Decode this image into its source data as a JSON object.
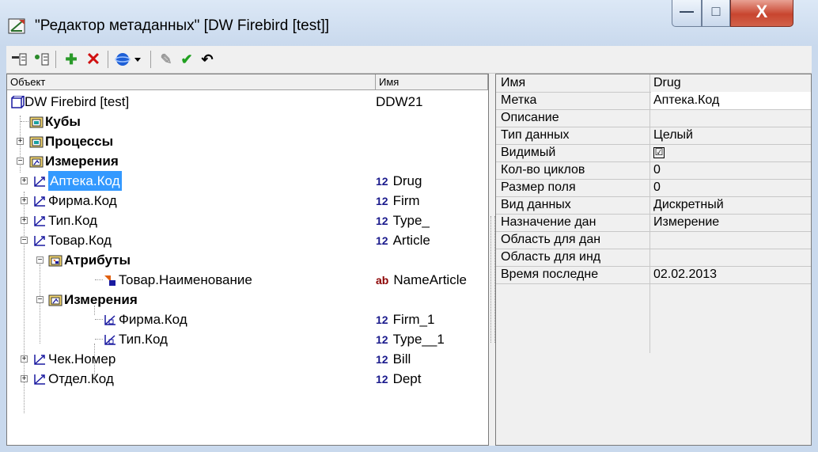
{
  "window": {
    "title": "\"Редактор метаданных\" [DW Firebird [test]]"
  },
  "window_controls": {
    "minimize": "—",
    "maximize": "□",
    "close": "X"
  },
  "toolbar": {
    "buttons": [
      "insert-before",
      "insert-after",
      "add",
      "delete",
      "globe-dropdown",
      "edit",
      "apply",
      "undo"
    ]
  },
  "tree": {
    "col_object": "Объект",
    "col_name": "Имя",
    "rows": [
      {
        "label": "DW Firebird [test]",
        "value": "DDW21",
        "prefix": ""
      },
      {
        "label": "Кубы",
        "value": "",
        "prefix": ""
      },
      {
        "label": "Процессы",
        "value": "",
        "prefix": ""
      },
      {
        "label": "Измерения",
        "value": "",
        "prefix": ""
      },
      {
        "label": "Аптека.Код",
        "value": "Drug",
        "prefix": "12"
      },
      {
        "label": "Фирма.Код",
        "value": "Firm",
        "prefix": "12"
      },
      {
        "label": "Тип.Код",
        "value": "Type_",
        "prefix": "12"
      },
      {
        "label": "Товар.Код",
        "value": "Article",
        "prefix": "12"
      },
      {
        "label": "Атрибуты",
        "value": "",
        "prefix": ""
      },
      {
        "label": "Товар.Наименование",
        "value": "NameArticle",
        "prefix": "ab"
      },
      {
        "label": "Измерения",
        "value": "",
        "prefix": ""
      },
      {
        "label": "Фирма.Код",
        "value": "Firm_1",
        "prefix": "12"
      },
      {
        "label": "Тип.Код",
        "value": "Type__1",
        "prefix": "12"
      },
      {
        "label": "Чек.Номер",
        "value": "Bill",
        "prefix": "12"
      },
      {
        "label": "Отдел.Код",
        "value": "Dept",
        "prefix": "12"
      }
    ]
  },
  "properties": {
    "rows": [
      {
        "key": "Имя",
        "value": "Drug"
      },
      {
        "key": "Метка",
        "value": "Аптека.Код"
      },
      {
        "key": "Описание",
        "value": ""
      },
      {
        "key": "Тип данных",
        "value": "Целый"
      },
      {
        "key": "Видимый",
        "value": "☑"
      },
      {
        "key": "Кол-во циклов",
        "value": "0"
      },
      {
        "key": "Размер поля",
        "value": "0"
      },
      {
        "key": "Вид данных",
        "value": "Дискретный"
      },
      {
        "key": "Назначение дан",
        "value": "Измерение"
      },
      {
        "key": "Область для дан",
        "value": ""
      },
      {
        "key": "Область для инд",
        "value": ""
      },
      {
        "key": "Время последне",
        "value": "02.02.2013"
      }
    ]
  },
  "colors": {
    "selection": "#3399ff",
    "prefix_num": "#1a1a8c",
    "prefix_ab": "#8b0000"
  }
}
